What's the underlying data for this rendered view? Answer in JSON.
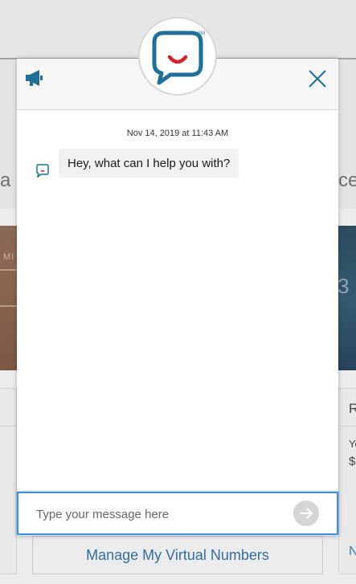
{
  "background": {
    "banner_left_text": "a l",
    "banner_right_text": "ce",
    "left_image_label": "MI",
    "right_image_text": "3",
    "right_card": {
      "header": "R",
      "line1": "Yo",
      "line2": "$",
      "link": "N"
    },
    "manage_button_label": "Manage My Virtual Numbers"
  },
  "chat": {
    "timestamp": "Nov 14, 2019 at 11:43 AM",
    "messages": [
      {
        "sender": "bot",
        "text": "Hey, what can I help you with?"
      }
    ],
    "input": {
      "value": "",
      "placeholder": "Type your message here"
    },
    "logo_mark": "SM"
  },
  "icons": {
    "announce": "megaphone-icon",
    "close": "close-icon",
    "send": "arrow-right-icon",
    "bot": "chat-bubble-smile-icon"
  },
  "colors": {
    "brand_blue": "#1f6f99",
    "smile_red": "#d7202a",
    "focus_blue": "#3d8fe6",
    "link_blue": "#2f6ea3"
  }
}
